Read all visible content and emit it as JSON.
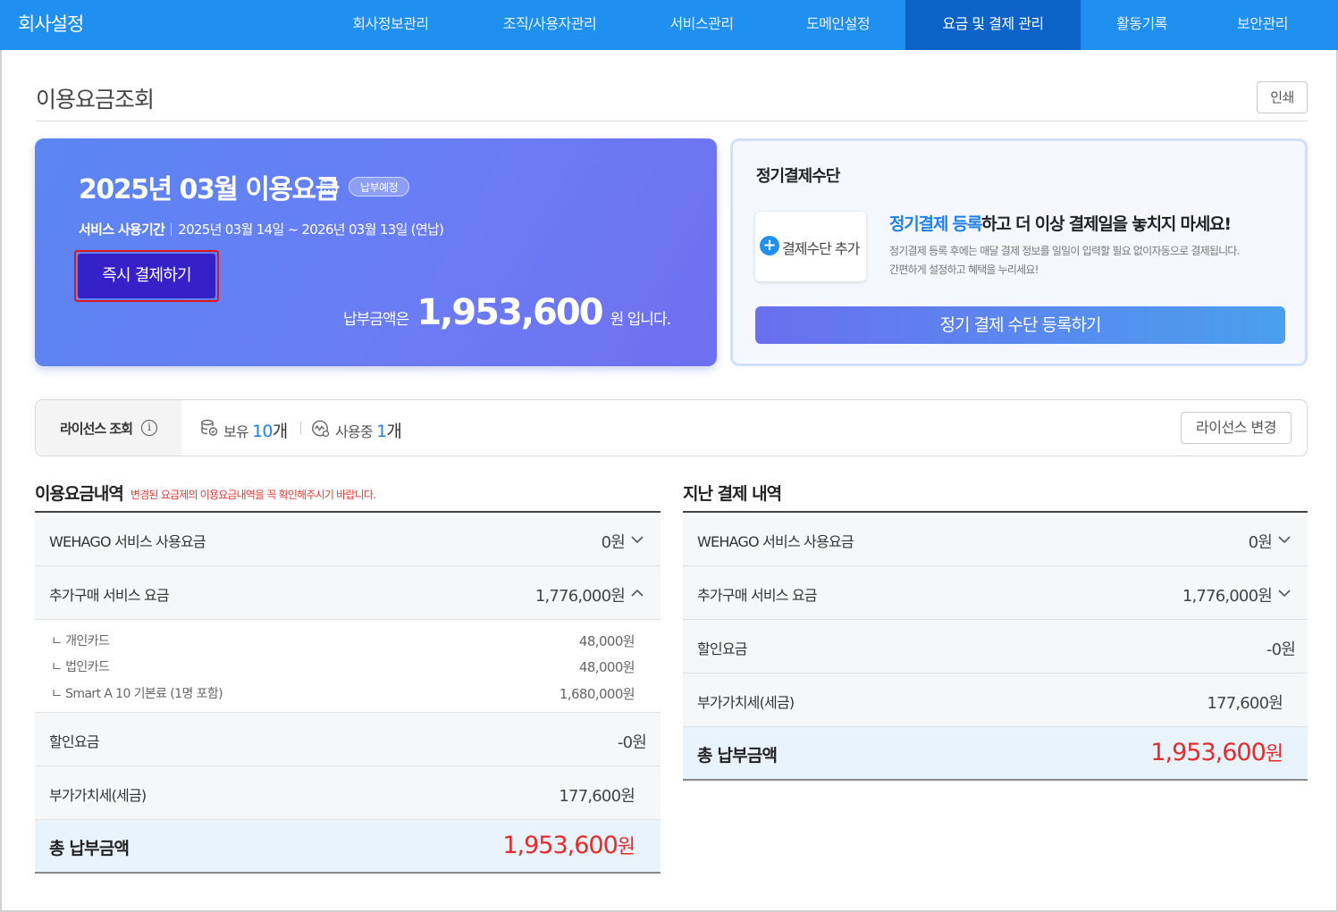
{
  "nav": {
    "brand": "회사설정",
    "items": [
      {
        "label": "회사정보관리",
        "active": false
      },
      {
        "label": "조직/사용자관리",
        "active": false
      },
      {
        "label": "서비스관리",
        "active": false
      },
      {
        "label": "도메인설정",
        "active": false
      },
      {
        "label": "요금 및 결제 관리",
        "active": true
      },
      {
        "label": "활동기록",
        "active": false
      },
      {
        "label": "보안관리",
        "active": false
      }
    ]
  },
  "page": {
    "title": "이용요금조회",
    "print_label": "인쇄"
  },
  "bill": {
    "title": "2025년 03월 이용요금",
    "status": "납부예정",
    "period_label": "서비스 사용기간",
    "period": "2025년 03월 14일 ~ 2026년 03월 13일  (연납)",
    "pay_now": "즉시 결제하기",
    "amount_prefix": "납부금액은",
    "amount": "1,953,600",
    "amount_suffix": "원 입니다."
  },
  "recurring": {
    "title": "정기결제수단",
    "add_label": "결제수단 추가",
    "head_highlight": "정기결제 등록",
    "head_rest": "하고 더 이상 결제일을 놓치지 마세요!",
    "desc_line1": "정기결제 등록 후에는 매달 결제 정보를 일일이 입력할 필요 없이자동으로 결제됩니다.",
    "desc_line2": "간편하게 설정하고 혜택을 누리세요!",
    "register_button": "정기 결제 수단 등록하기"
  },
  "license": {
    "label": "라이선스 조회",
    "owned_label": "보유",
    "owned_count": "10",
    "owned_unit": "개",
    "inuse_label": "사용중",
    "inuse_count": "1",
    "inuse_unit": "개",
    "change_button": "라이선스 변경"
  },
  "usage": {
    "title": "이용요금내역",
    "note": "변경된 요금제의 이용요금내역을 꼭 확인해주시기 바랍니다.",
    "rows": {
      "wehago": {
        "label": "WEHAGO 서비스 사용요금",
        "value": "0원"
      },
      "extra": {
        "label": "추가구매 서비스 요금",
        "value": "1,776,000원"
      },
      "discount": {
        "label": "할인요금",
        "value": "-0원"
      },
      "vat": {
        "label": "부가가치세(세금)",
        "value": "177,600원"
      },
      "total": {
        "label": "총 납부금액",
        "value": "1,953,600",
        "unit": "원"
      }
    },
    "sub_items": [
      {
        "label": "ㄴ 개인카드",
        "value": "48,000원"
      },
      {
        "label": "ㄴ 법인카드",
        "value": "48,000원"
      },
      {
        "label": "ㄴ Smart A 10 기본료 (1명 포함)",
        "value": "1,680,000원"
      }
    ]
  },
  "past": {
    "title": "지난 결제 내역",
    "rows": {
      "wehago": {
        "label": "WEHAGO 서비스 사용요금",
        "value": "0원"
      },
      "extra": {
        "label": "추가구매 서비스 요금",
        "value": "1,776,000원"
      },
      "discount": {
        "label": "할인요금",
        "value": "-0원"
      },
      "vat": {
        "label": "부가가치세(세금)",
        "value": "177,600원"
      },
      "total": {
        "label": "총 납부금액",
        "value": "1,953,600",
        "unit": "원"
      }
    }
  },
  "colors": {
    "nav_bg": "#1f8ff0",
    "nav_active": "#0b63c8",
    "accent_blue": "#1f7fee",
    "total_red": "#e42b2b",
    "pay_button": "#3620c8"
  }
}
